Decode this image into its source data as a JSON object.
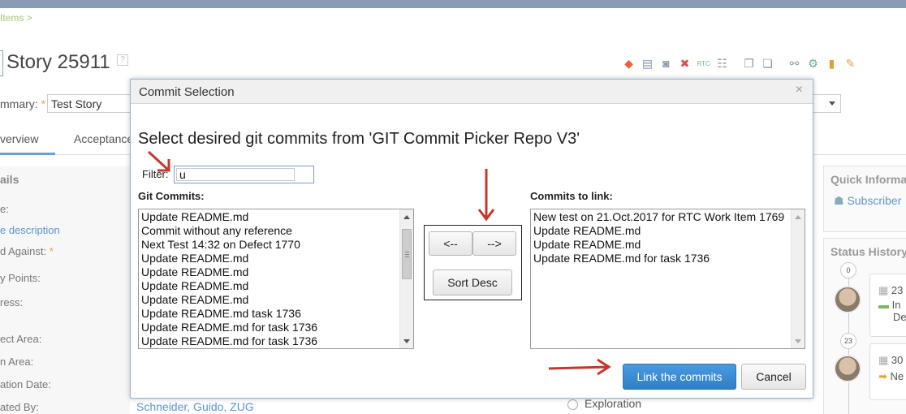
{
  "background": {
    "breadcrumb": "Items >",
    "page_title": "Story 25911",
    "help_icon": "?",
    "summary": {
      "label": "mmary:",
      "star": "*",
      "value": "Test Story"
    },
    "tabs": [
      {
        "label": "verview"
      },
      {
        "label": "Acceptance"
      }
    ],
    "left_labels": {
      "details_heading": "ails",
      "type": "e:",
      "description_link": "e description",
      "found_against": "d Against:",
      "found_against_star": "*",
      "story_points": "y Points:",
      "progress": "ress:",
      "project_area": "ect Area:",
      "team_area": "n Area:",
      "creation_date": "ation Date:",
      "created_by": "ated By:"
    },
    "created_by_value": "Schneider, Guido, ZUG",
    "radio_option": "Exploration",
    "quick_info": {
      "title": "Quick Informa",
      "subscribers": "Subscriber"
    },
    "status_history": {
      "title": "Status History",
      "badges": [
        "0",
        "23"
      ],
      "card1": [
        "23",
        "In",
        "De"
      ],
      "card2": [
        "30",
        "Ne"
      ]
    },
    "toolbar_icons": [
      "workflow-icon",
      "print-icon",
      "camera-icon",
      "delete-icon",
      "rtc-icon",
      "hierarchy-icon",
      "copy-icon",
      "duplicate-icon",
      "link-icon",
      "merge-icon",
      "clipboard-icon",
      "edit-icon"
    ]
  },
  "modal": {
    "title": "Commit Selection",
    "close_label": "×",
    "heading": "Select desired git commits from 'GIT Commit Picker Repo V3'",
    "filter_label": "Filter:",
    "filter_value": "u",
    "git_commits_label": "Git Commits:",
    "git_commits": [
      "Update README.md",
      "Commit without any reference",
      "Next Test 14:32 on Defect 1770",
      "Update README.md",
      "Update README.md",
      "Update README.md",
      "Update README.md",
      "Update README.md task 1736",
      "Update README.md for task 1736",
      "Update README.md for task 1736"
    ],
    "move_left_label": "<--",
    "move_right_label": "-->",
    "sort_label": "Sort Desc",
    "commits_to_link_label": "Commits to link:",
    "commits_to_link": [
      "New test on 21.Oct.2017 for RTC Work Item 1769",
      "Update README.md",
      "Update README.md",
      "Update README.md for task 1736"
    ],
    "link_button_label": "Link the commits",
    "cancel_button_label": "Cancel"
  },
  "colors": {
    "annotation_arrow": "#c0392b",
    "primary_button": "#3a8ad4",
    "modal_border": "#8fb6dd",
    "link": "#5b95cc"
  }
}
